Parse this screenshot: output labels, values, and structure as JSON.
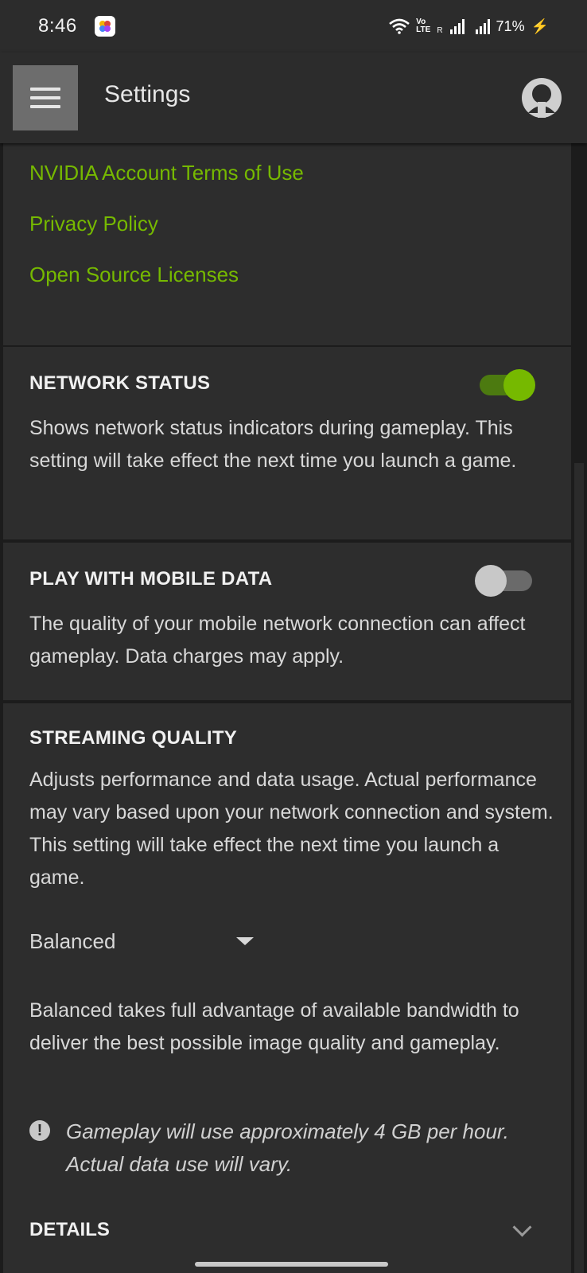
{
  "status_bar": {
    "time": "8:46",
    "volte_top": "Vo",
    "volte_bottom": "LTE",
    "roaming": "R",
    "battery": "71%"
  },
  "app_bar": {
    "title": "Settings"
  },
  "links": [
    "NVIDIA Account Terms of Use",
    "Privacy Policy",
    "Open Source Licenses"
  ],
  "network_status": {
    "heading": "NETWORK STATUS",
    "description": "Shows network status indicators during gameplay. This setting will take effect the next time you launch a game.",
    "enabled": true
  },
  "mobile_data": {
    "heading": "PLAY WITH MOBILE DATA",
    "description": "The quality of your mobile network connection can affect gameplay. Data charges may apply.",
    "enabled": false
  },
  "streaming_quality": {
    "heading": "STREAMING QUALITY",
    "description": "Adjusts performance and data usage. Actual performance may vary based upon your network connection and system. This setting will take effect the next time you launch a game.",
    "selected": "Balanced",
    "selected_description": "Balanced takes full advantage of available bandwidth to deliver the best possible image quality and gameplay.",
    "warning_icon": "!",
    "warning": "Gameplay will use approximately 4 GB per hour. Actual data use will vary.",
    "details_label": "DETAILS"
  },
  "colors": {
    "accent": "#76b900",
    "card": "#2d2d2d",
    "background": "#1c1c1c"
  }
}
